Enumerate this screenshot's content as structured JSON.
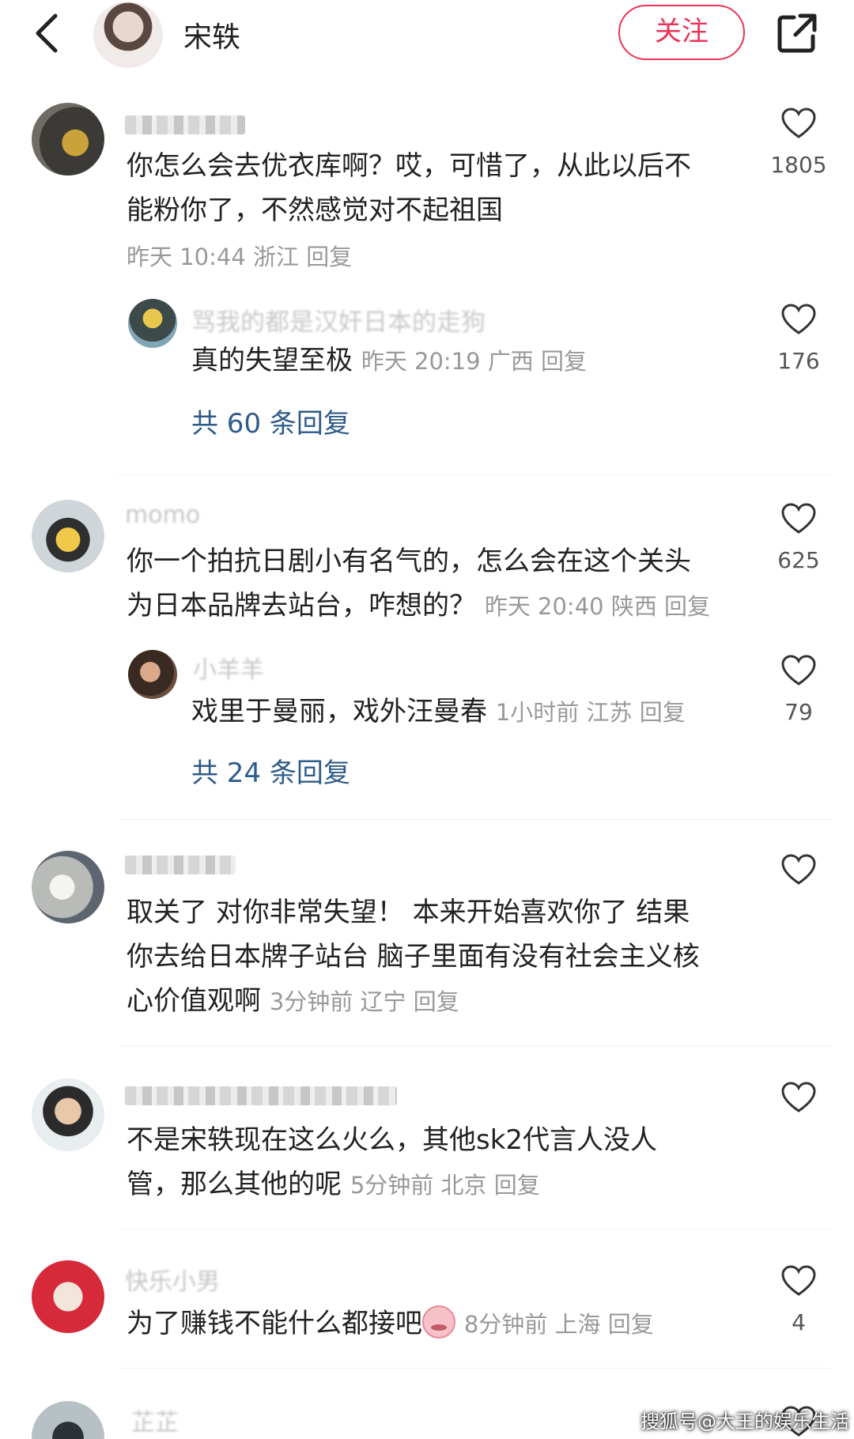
{
  "header": {
    "back_icon": "chevron-left-icon",
    "name": "宋轶",
    "follow_label": "关注",
    "share_icon": "share-external-icon"
  },
  "comments": [
    {
      "text": "你怎么会去优衣库啊？哎，可惜了，从此以后不能粉你了，不然感觉对不起祖国",
      "line1": "你怎么会去优衣库啊？哎，可惜了，从此以后不",
      "line2": "能粉你了，不然感觉对不起祖国",
      "meta": "昨天 10:44 浙江 回复",
      "likes": "1805",
      "reply": {
        "masked_text": "骂我的都是汉奸日本的走狗",
        "text": "真的失望至极",
        "meta": "昨天 20:19 广西 回复",
        "likes": "176"
      },
      "more_replies": "共 60 条回复"
    },
    {
      "masked_name": "momo",
      "line1": "你一个拍抗日剧小有名气的，怎么会在这个关头",
      "line2": "为日本品牌去站台，咋想的？",
      "meta": "昨天 20:40 陕西 回复",
      "likes": "625",
      "reply": {
        "masked_name": "小羊羊",
        "text": "戏里于曼丽，戏外汪曼春",
        "meta": "1小时前 江苏 回复",
        "likes": "79"
      },
      "more_replies": "共 24 条回复"
    },
    {
      "line1": "取关了 对你非常失望！ 本来开始喜欢你了 结果",
      "line2": "你去给日本牌子站台 脑子里面有没有社会主义核",
      "line3": "心价值观啊",
      "meta": "3分钟前 辽宁 回复"
    },
    {
      "line1": "不是宋轶现在这么火么，其他sk2代言人没人",
      "line2": "管，那么其他的呢",
      "meta": "5分钟前 北京 回复"
    },
    {
      "masked_name": "快乐小男",
      "line1": "为了赚钱不能什么都接吧",
      "meta": "8分钟前 上海 回复",
      "likes": "4"
    },
    {
      "masked_name": "芷芷"
    }
  ],
  "icons": {
    "heart": "heart-outline-icon"
  },
  "watermark": "搜狐号@大王的娱乐生活"
}
